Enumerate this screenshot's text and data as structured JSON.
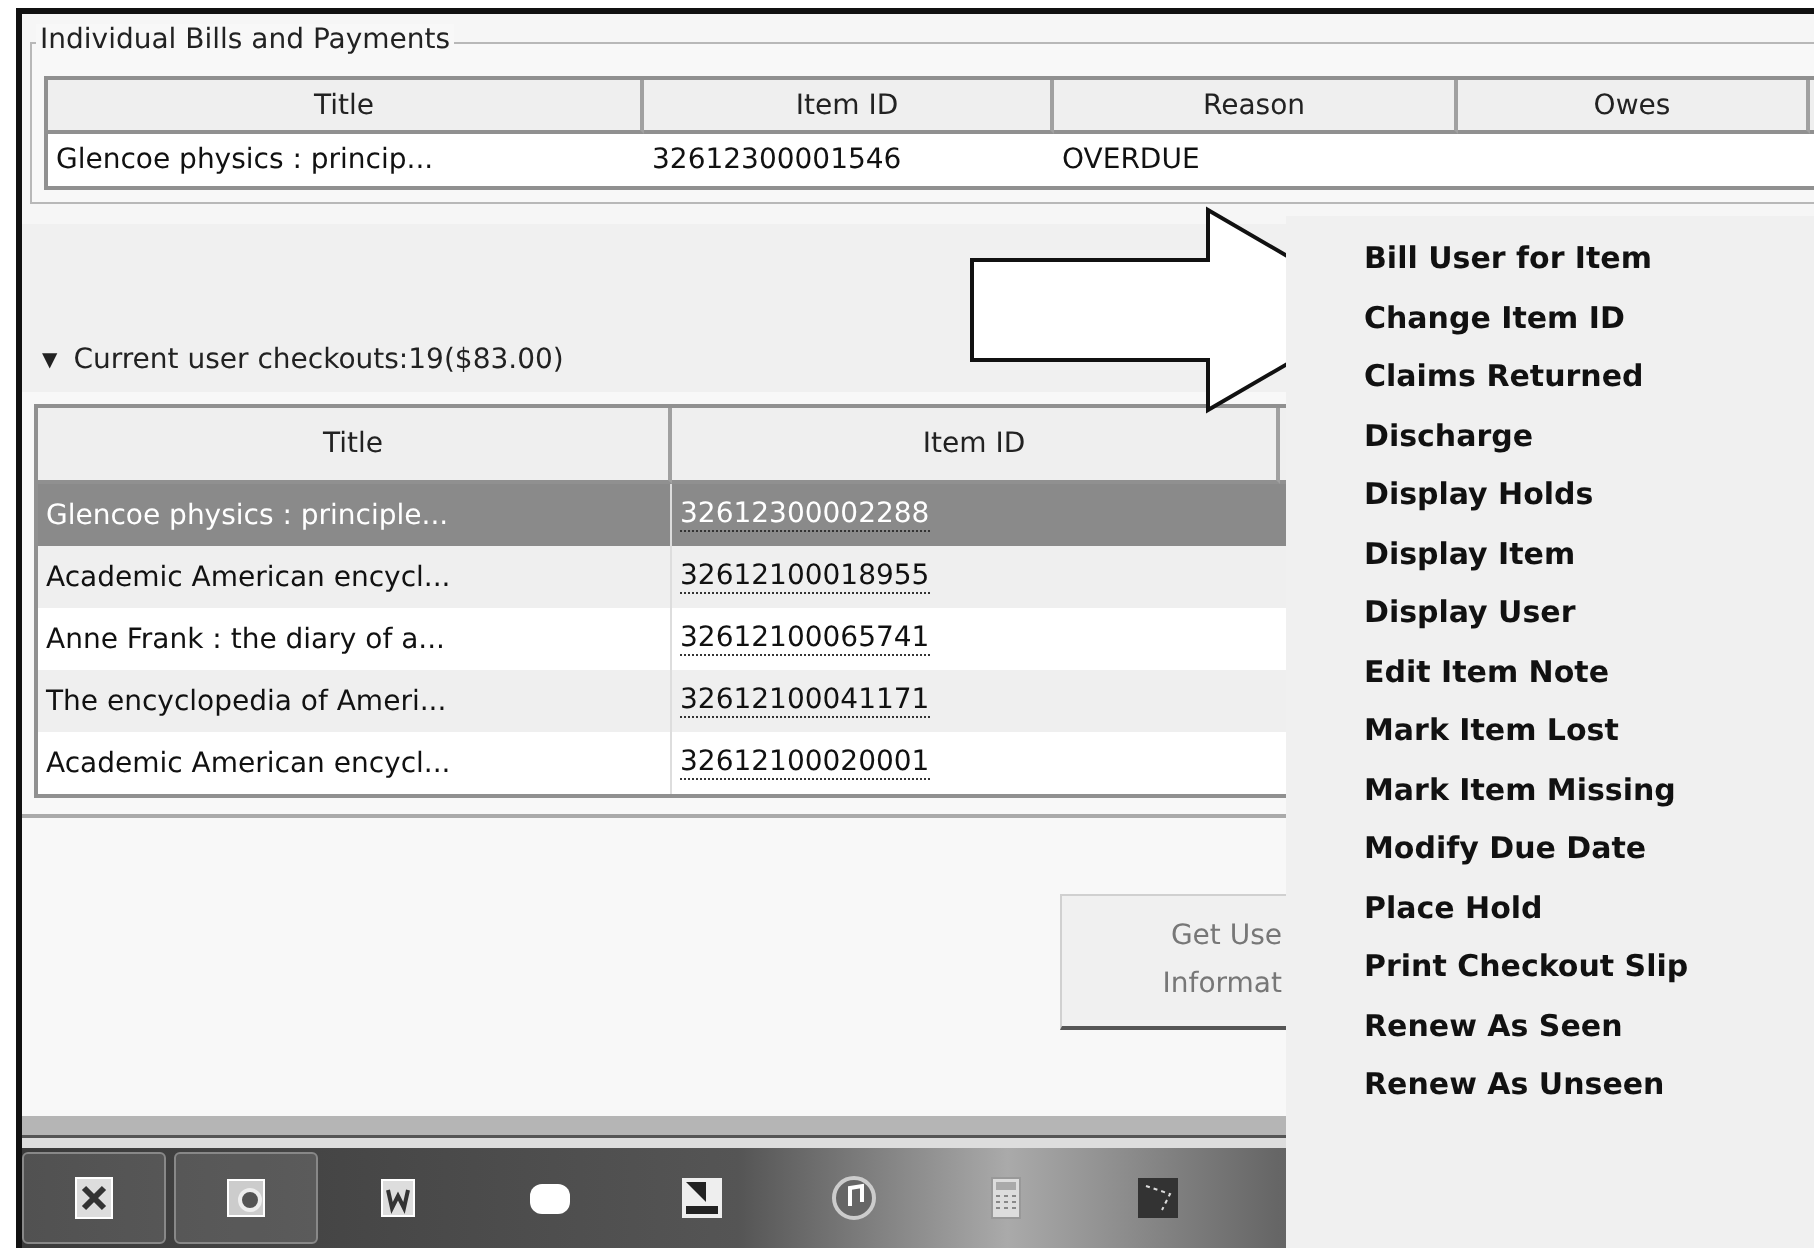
{
  "bills": {
    "legend": "Individual Bills and Payments",
    "columns": [
      "Title",
      "Item ID",
      "Reason",
      "Owes"
    ],
    "rows": [
      {
        "cells": [
          "Glencoe physics : princip...",
          "32612300001546",
          "OVERDUE"
        ]
      }
    ]
  },
  "checkouts": {
    "expanded": true,
    "toggle": "▼",
    "label": "Current user checkouts:19($83.00)",
    "columns": [
      "Title",
      "Item ID"
    ],
    "rows": [
      {
        "title": "Glencoe physics : principle...",
        "item_id": "32612300002288",
        "selected": true
      },
      {
        "title": "Academic American encycl...",
        "item_id": "32612100018955",
        "selected": false
      },
      {
        "title": "Anne Frank : the diary of a...",
        "item_id": "32612100065741",
        "selected": false
      },
      {
        "title": "The encyclopedia of Ameri...",
        "item_id": "32612100041171",
        "selected": false
      },
      {
        "title": "Academic American encycl...",
        "item_id": "32612100020001",
        "selected": false
      }
    ]
  },
  "button": {
    "lines": [
      "Get Use",
      "Informat"
    ],
    "disabled": true
  },
  "context_menu": {
    "items": [
      "Bill User for Item",
      "Change Item ID",
      "Claims Returned",
      "Discharge",
      "Display Holds",
      "Display Item",
      "Display User",
      "Edit Item Note",
      "Mark Item Lost",
      "Mark Item Missing",
      "Modify Due Date",
      "Place Hold",
      "Print Checkout Slip",
      "Renew As Seen",
      "Renew As Unseen"
    ]
  }
}
